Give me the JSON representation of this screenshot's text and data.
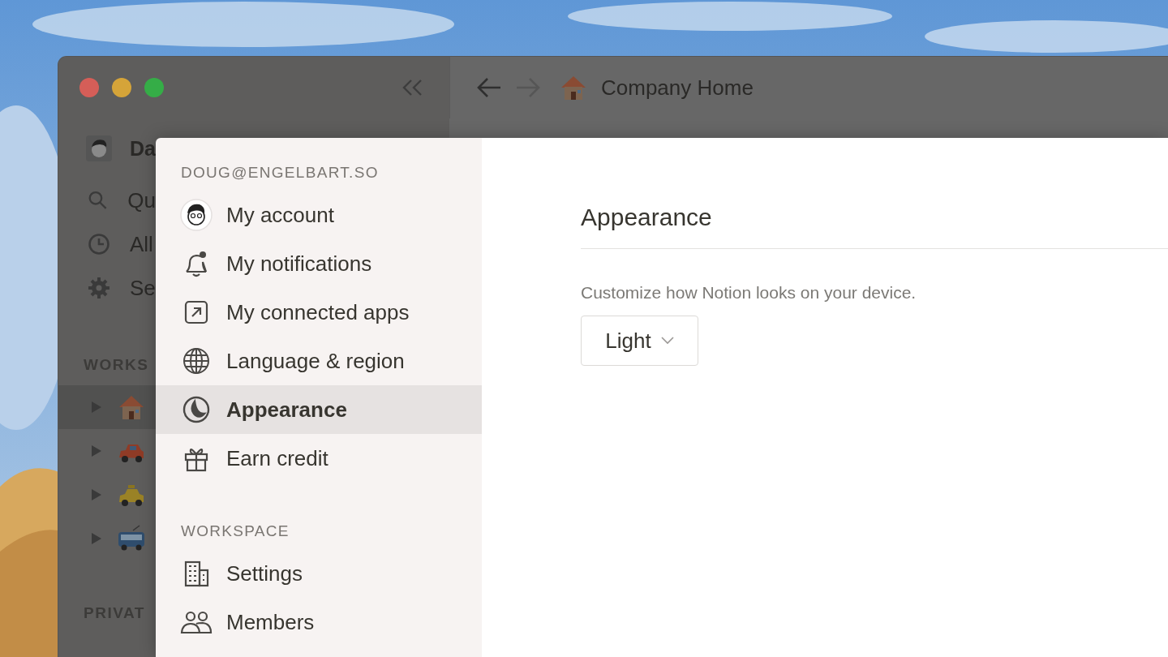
{
  "sidebar": {
    "workspace_name": "Da",
    "items": [
      {
        "label": "Qu"
      },
      {
        "label": "All"
      },
      {
        "label": "Se"
      }
    ],
    "section_label": "WORKS",
    "pages": [
      {
        "selected": true
      },
      {
        "selected": false
      },
      {
        "selected": false
      },
      {
        "selected": false
      }
    ],
    "private_label": "PRIVAT"
  },
  "topbar": {
    "title": "Company Home"
  },
  "settings": {
    "account_label": "DOUG@ENGELBART.SO",
    "account_items": [
      {
        "label": "My account",
        "selected": false
      },
      {
        "label": "My notifications",
        "selected": false
      },
      {
        "label": "My connected apps",
        "selected": false
      },
      {
        "label": "Language & region",
        "selected": false
      },
      {
        "label": "Appearance",
        "selected": true
      },
      {
        "label": "Earn credit",
        "selected": false
      }
    ],
    "workspace_label": "WORKSPACE",
    "workspace_items": [
      {
        "label": "Settings",
        "selected": false
      },
      {
        "label": "Members",
        "selected": false
      }
    ],
    "heading": "Appearance",
    "description": "Customize how Notion looks on your device.",
    "theme": {
      "value": "Light"
    }
  }
}
